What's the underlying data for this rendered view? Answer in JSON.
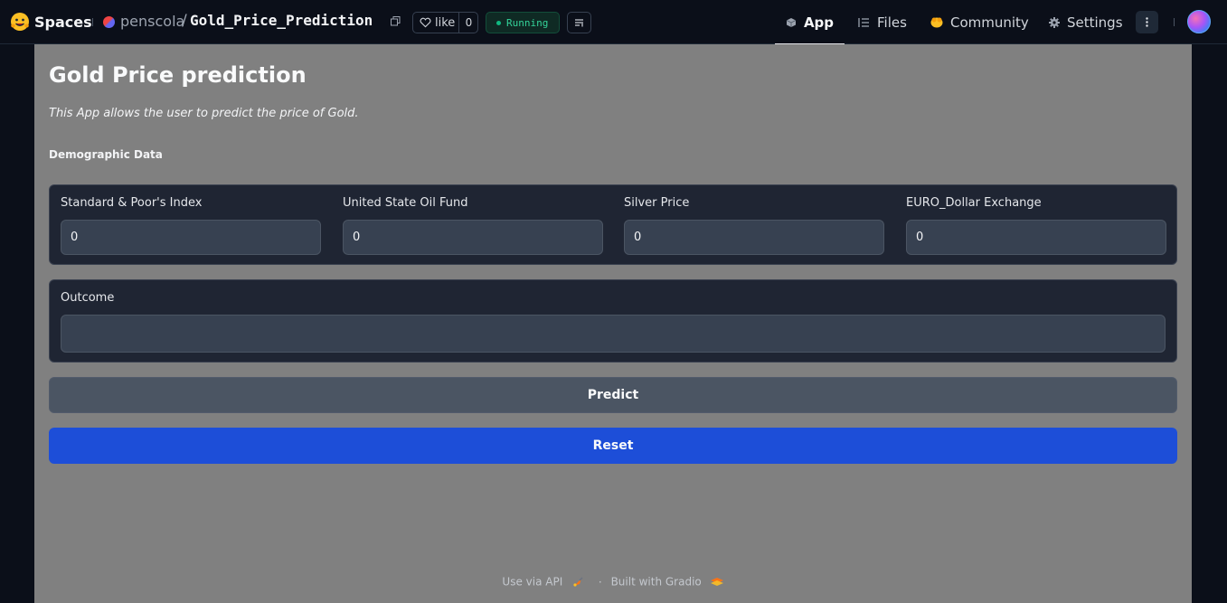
{
  "topbar": {
    "brand": "Spaces",
    "owner": "penscola",
    "slash": "/",
    "repo": "Gold_Price_Prediction",
    "like_label": "like",
    "like_count": "0",
    "status": "Running",
    "tabs": [
      {
        "label": "App",
        "icon": "cube-icon",
        "active": true
      },
      {
        "label": "Files",
        "icon": "files-icon",
        "active": false
      },
      {
        "label": "Community",
        "icon": "community-icon",
        "active": false
      },
      {
        "label": "Settings",
        "icon": "gear-icon",
        "active": false
      }
    ]
  },
  "app": {
    "title": "Gold Price prediction",
    "description": "This App allows the user to predict the price of Gold.",
    "section_label": "Demographic Data",
    "fields": [
      {
        "label": "Standard & Poor's Index",
        "value": "0"
      },
      {
        "label": "United State Oil Fund",
        "value": "0"
      },
      {
        "label": "Silver Price",
        "value": "0"
      },
      {
        "label": "EURO_Dollar Exchange",
        "value": "0"
      }
    ],
    "outcome_label": "Outcome",
    "outcome_value": "",
    "predict_label": "Predict",
    "reset_label": "Reset"
  },
  "footer": {
    "api_label": "Use via API",
    "separator": "·",
    "built_label": "Built with Gradio"
  },
  "colors": {
    "accent": "#1d4ed8",
    "status": "#34d399",
    "frame_bg": "#808080",
    "panel_bg": "#1f2533"
  }
}
